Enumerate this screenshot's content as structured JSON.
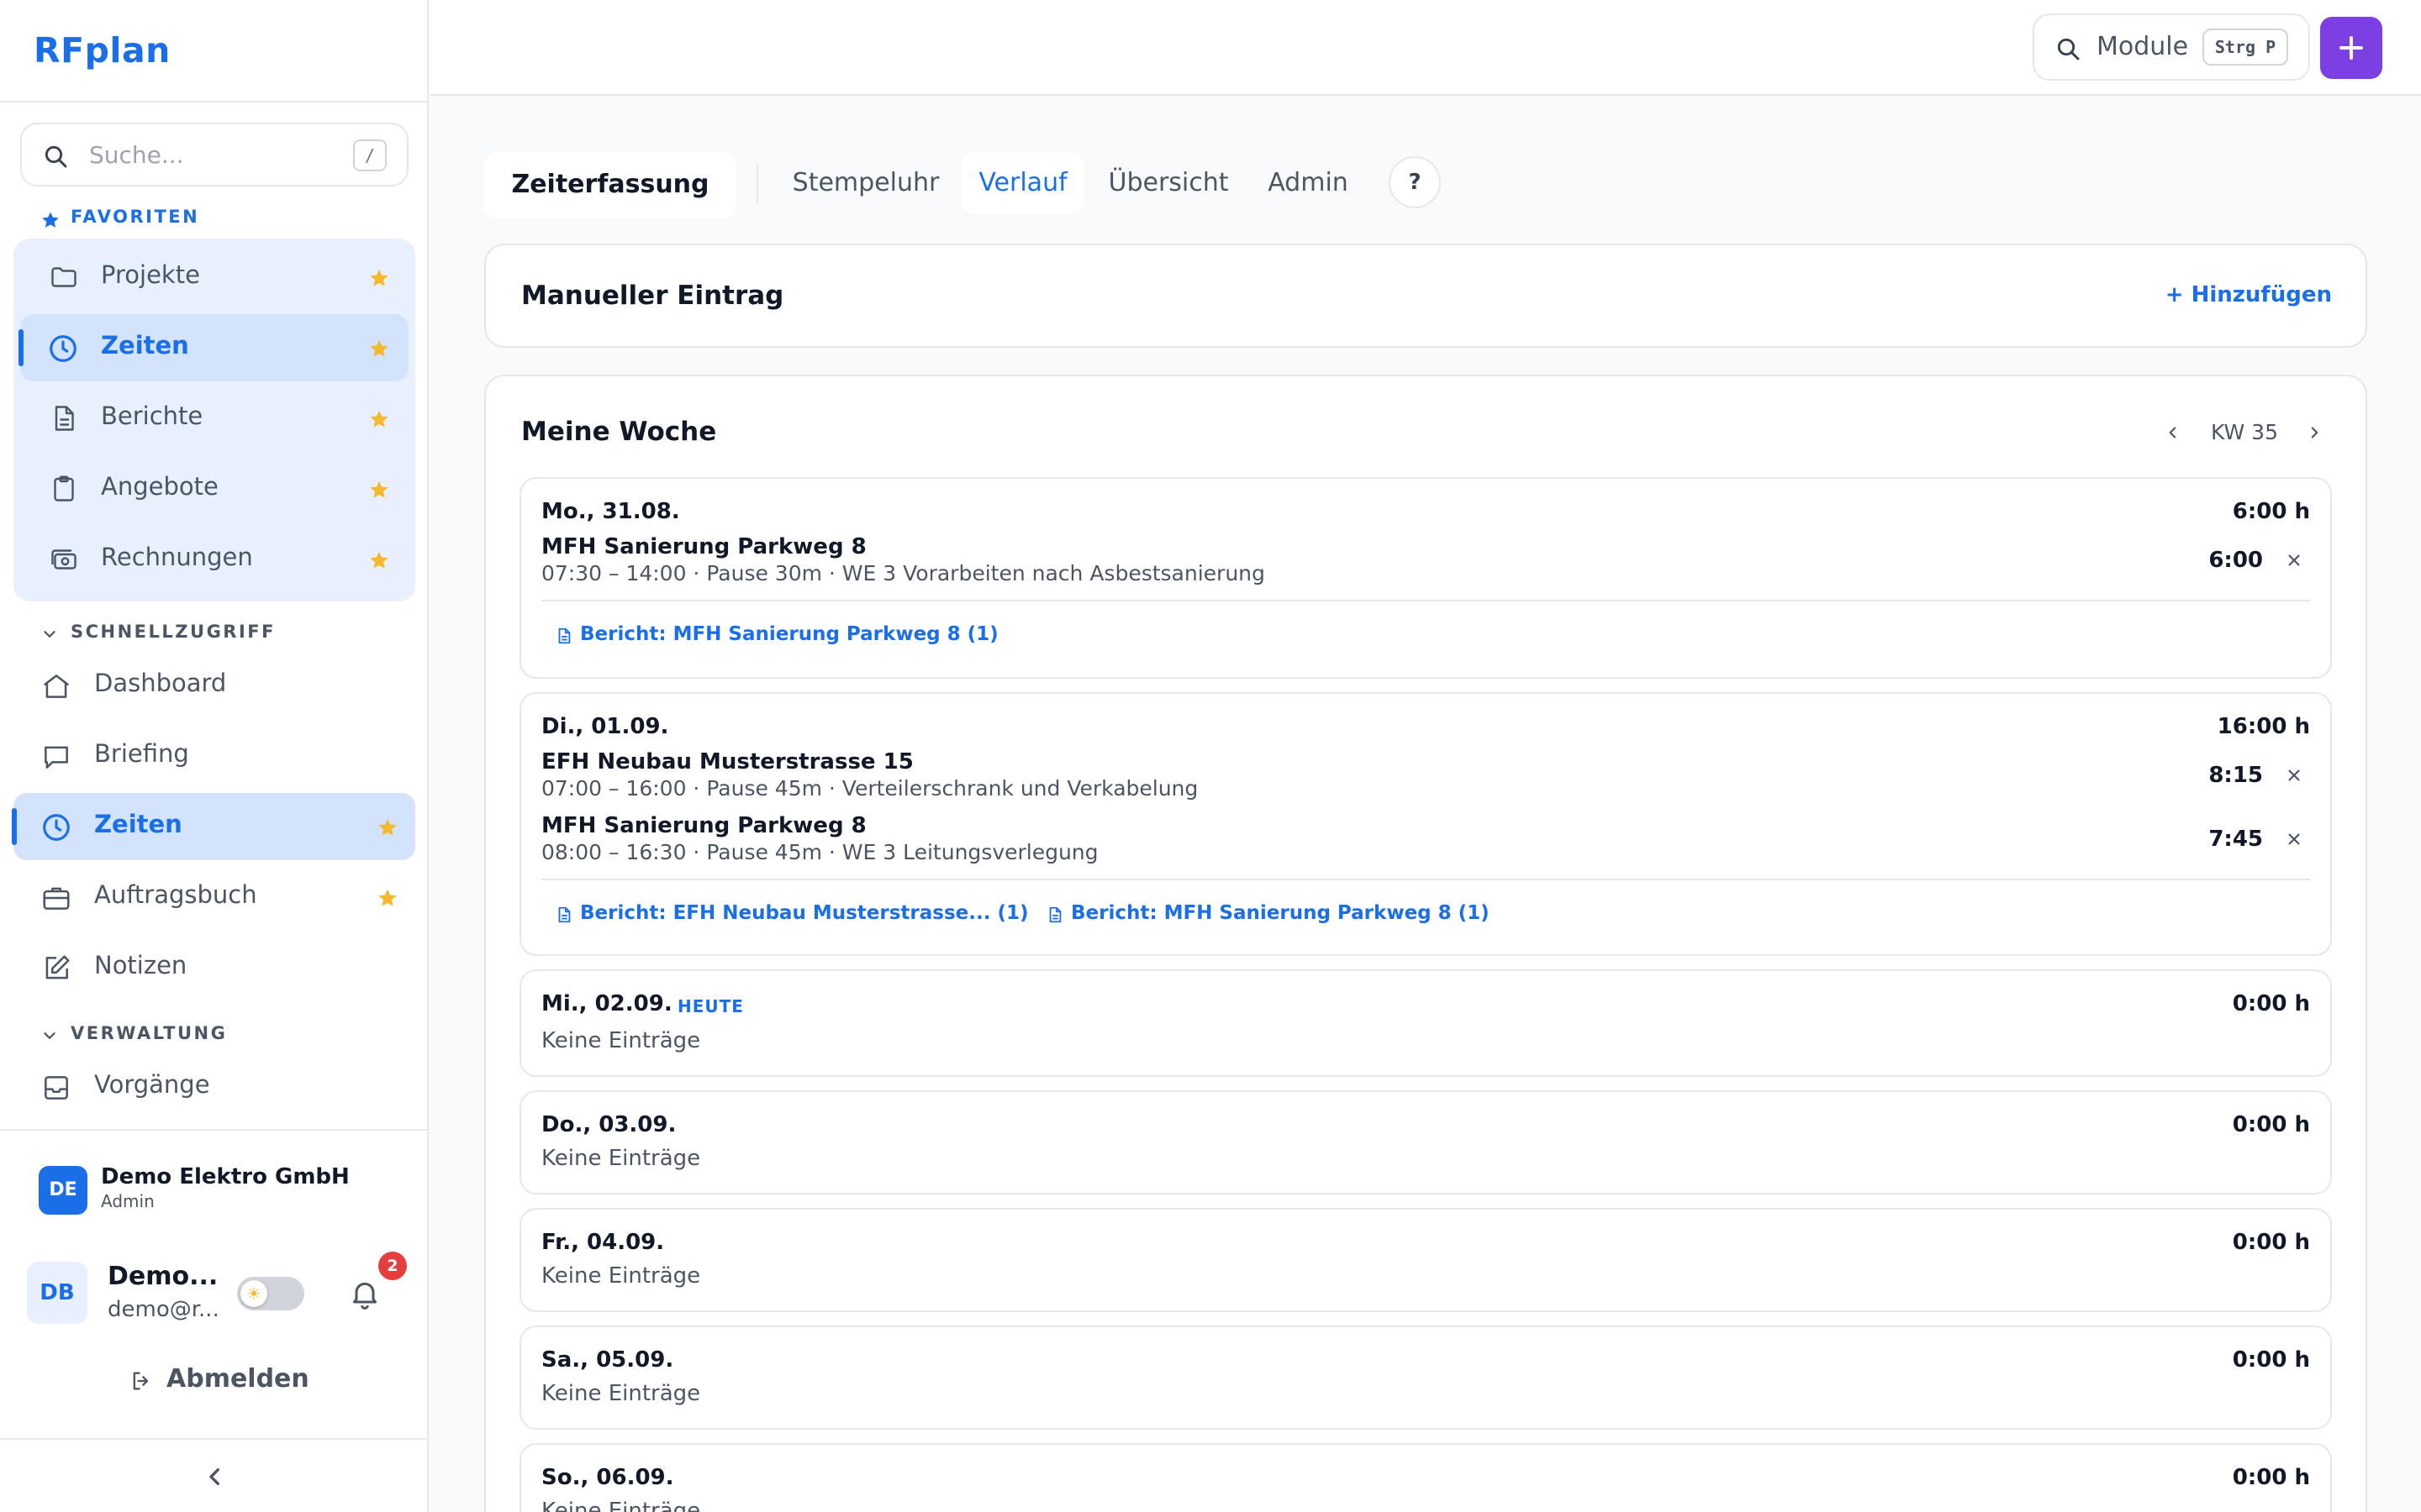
{
  "app": {
    "title": "RFplan"
  },
  "sidebar": {
    "search": {
      "placeholder": "Suche...",
      "shortcut": "/"
    },
    "favorites_label": "FAVORITEN",
    "favorites": [
      {
        "label": "Projekte",
        "icon": "folder-icon"
      },
      {
        "label": "Zeiten",
        "icon": "clock-icon",
        "active": true
      },
      {
        "label": "Berichte",
        "icon": "document-icon"
      },
      {
        "label": "Angebote",
        "icon": "clipboard-icon"
      },
      {
        "label": "Rechnungen",
        "icon": "cash-icon"
      }
    ],
    "quick_label": "SCHNELLZUGRIFF",
    "quick": [
      {
        "label": "Dashboard",
        "icon": "home-icon"
      },
      {
        "label": "Briefing",
        "icon": "chat-icon"
      },
      {
        "label": "Zeiten",
        "icon": "clock-icon",
        "active": true,
        "starred": true
      },
      {
        "label": "Auftragsbuch",
        "icon": "briefcase-icon",
        "starred": true
      },
      {
        "label": "Notizen",
        "icon": "edit-icon"
      }
    ],
    "admin_label": "VERWALTUNG",
    "admin": [
      {
        "label": "Vorgänge",
        "icon": "inbox-icon"
      }
    ],
    "org": {
      "initials": "DE",
      "name": "Demo Elektro GmbH",
      "role": "Admin"
    },
    "user": {
      "initials": "DB",
      "name": "Demo...",
      "email": "demo@r...",
      "notifications": "2"
    },
    "logout_label": "Abmelden"
  },
  "topbar": {
    "module_search": "Module",
    "module_shortcut": "Strg P"
  },
  "tabs": {
    "title": "Zeiterfassung",
    "items": [
      "Stempeluhr",
      "Verlauf",
      "Übersicht",
      "Admin"
    ],
    "active": "Verlauf",
    "help": "?"
  },
  "manual": {
    "title": "Manueller Eintrag",
    "add_label": "+ Hinzufügen"
  },
  "week": {
    "title": "Meine Woche",
    "label": "KW 35",
    "empty_text": "Keine Einträge",
    "today_label": "HEUTE",
    "days": [
      {
        "date": "Mo., 31.08.",
        "total": "6:00 h",
        "entries": [
          {
            "title": "MFH Sanierung Parkweg 8",
            "meta": "07:30 – 14:00 · Pause 30m · WE 3 Vorarbeiten nach Asbestsanierung",
            "duration": "6:00"
          }
        ],
        "reports": [
          "Bericht: MFH Sanierung Parkweg 8 (1)"
        ]
      },
      {
        "date": "Di., 01.09.",
        "total": "16:00 h",
        "entries": [
          {
            "title": "EFH Neubau Musterstrasse 15",
            "meta": "07:00 – 16:00 · Pause 45m · Verteilerschrank und Verkabelung",
            "duration": "8:15"
          },
          {
            "title": "MFH Sanierung Parkweg 8",
            "meta": "08:00 – 16:30 · Pause 45m · WE 3 Leitungsverlegung",
            "duration": "7:45"
          }
        ],
        "reports": [
          "Bericht: EFH Neubau Musterstrasse... (1)",
          "Bericht: MFH Sanierung Parkweg 8 (1)"
        ]
      },
      {
        "date": "Mi., 02.09.",
        "total": "0:00 h",
        "today": true
      },
      {
        "date": "Do., 03.09.",
        "total": "0:00 h"
      },
      {
        "date": "Fr., 04.09.",
        "total": "0:00 h"
      },
      {
        "date": "Sa., 05.09.",
        "total": "0:00 h"
      },
      {
        "date": "So., 06.09.",
        "total": "0:00 h"
      }
    ]
  },
  "colors": {
    "accent": "#1a6fe8",
    "add_button": "#7b3fe4",
    "star": "#f5b82e",
    "badge": "#e53e3e"
  }
}
